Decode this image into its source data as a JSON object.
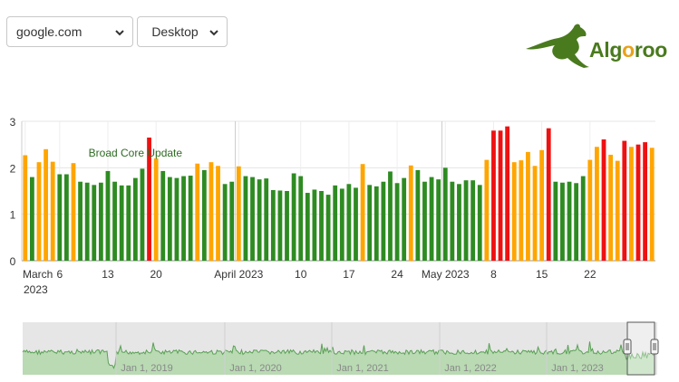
{
  "controls": {
    "domain_value": "google.com",
    "device_value": "Desktop"
  },
  "logo": {
    "text_prefix": "Alg",
    "text_highlight": "o",
    "text_suffix": "roo",
    "brand_color": "#4a7a1e",
    "accent_color": "#e8a21a"
  },
  "chart_data": {
    "type": "bar",
    "y_ticks": [
      "0",
      "1",
      "2",
      "3"
    ],
    "ylim": [
      0,
      3
    ],
    "grid": true,
    "x_tick_labels": [
      {
        "label": "March",
        "sub": "2023",
        "day": 0
      },
      {
        "label": "6",
        "day": 5
      },
      {
        "label": "13",
        "day": 12
      },
      {
        "label": "20",
        "day": 19
      },
      {
        "label": "April 2023",
        "day": 31
      },
      {
        "label": "10",
        "day": 40
      },
      {
        "label": "17",
        "day": 47
      },
      {
        "label": "24",
        "day": 54
      },
      {
        "label": "May 2023",
        "day": 61
      },
      {
        "label": "8",
        "day": 68
      },
      {
        "label": "15",
        "day": 75
      },
      {
        "label": "22",
        "day": 82
      }
    ],
    "annotation": {
      "text": "Broad Core Update",
      "day": 16
    },
    "colors": {
      "low": "#2e8b22",
      "medium": "#ffa500",
      "high": "#ee1111"
    },
    "values": [
      2.27,
      1.8,
      2.12,
      2.4,
      2.13,
      1.86,
      1.86,
      2.1,
      1.7,
      1.68,
      1.63,
      1.68,
      1.93,
      1.7,
      1.62,
      1.62,
      1.78,
      1.98,
      2.65,
      2.2,
      1.93,
      1.8,
      1.78,
      1.82,
      1.83,
      2.09,
      1.95,
      2.12,
      2.04,
      1.65,
      1.7,
      2.03,
      1.82,
      1.8,
      1.75,
      1.77,
      1.52,
      1.51,
      1.5,
      1.88,
      1.82,
      1.46,
      1.53,
      1.5,
      1.42,
      1.62,
      1.55,
      1.65,
      1.57,
      2.08,
      1.63,
      1.6,
      1.7,
      1.92,
      1.67,
      1.78,
      2.05,
      1.95,
      1.7,
      1.8,
      1.75,
      2.0,
      1.7,
      1.65,
      1.73,
      1.73,
      1.63,
      2.17,
      2.8,
      2.8,
      2.89,
      2.12,
      2.16,
      2.34,
      2.04,
      2.38,
      2.85,
      1.7,
      1.68,
      1.7,
      1.67,
      1.82,
      2.17,
      2.45,
      2.61,
      2.28,
      2.15,
      2.58,
      2.45,
      2.5,
      2.55,
      2.43
    ],
    "levels": [
      "m",
      "l",
      "m",
      "m",
      "m",
      "l",
      "l",
      "m",
      "l",
      "l",
      "l",
      "l",
      "l",
      "l",
      "l",
      "l",
      "l",
      "l",
      "h",
      "m",
      "l",
      "l",
      "l",
      "l",
      "l",
      "m",
      "l",
      "m",
      "m",
      "l",
      "l",
      "m",
      "l",
      "l",
      "l",
      "l",
      "l",
      "l",
      "l",
      "l",
      "l",
      "l",
      "l",
      "l",
      "l",
      "l",
      "l",
      "l",
      "l",
      "m",
      "l",
      "l",
      "l",
      "l",
      "l",
      "l",
      "m",
      "l",
      "l",
      "l",
      "l",
      "l",
      "l",
      "l",
      "l",
      "l",
      "l",
      "m",
      "h",
      "h",
      "h",
      "m",
      "m",
      "m",
      "m",
      "m",
      "h",
      "l",
      "l",
      "l",
      "l",
      "l",
      "m",
      "m",
      "h",
      "m",
      "m",
      "h",
      "m",
      "h",
      "h",
      "m"
    ]
  },
  "navigator": {
    "labels": [
      "Jan 1, 2019",
      "Jan 1, 2020",
      "Jan 1, 2021",
      "Jan 1, 2022",
      "Jan 1, 2023"
    ],
    "line_color": "#5aa055",
    "fill_color": "#b9dab3"
  }
}
